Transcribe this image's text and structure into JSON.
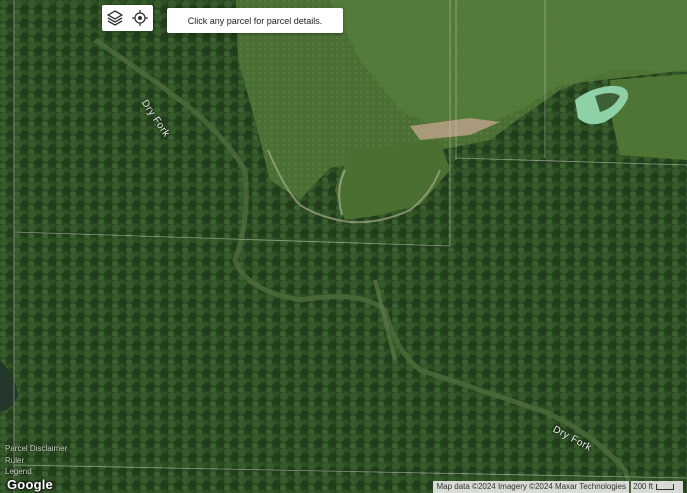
{
  "map": {
    "type": "satellite",
    "labels": {
      "dry_fork_upper": "Dry Fork",
      "dry_fork_lower": "Dry Fork"
    }
  },
  "controls": {
    "layers_icon": "layers-icon",
    "locate_icon": "locate-icon"
  },
  "notice": {
    "text": "Click any parcel for parcel details."
  },
  "side_links": {
    "disclaimer": "Parcel Disclaimer",
    "ruler": "Ruler",
    "legend": "Legend"
  },
  "footer": {
    "logo": "Google",
    "attribution": "Map data ©2024 Imagery ©2024 Maxar Technologies",
    "scale_label": "200 ft"
  },
  "colors": {
    "forest": "#2c4a22",
    "field": "#4f7336",
    "pond": "#7fc79a",
    "panel_bg": "#ffffff"
  }
}
